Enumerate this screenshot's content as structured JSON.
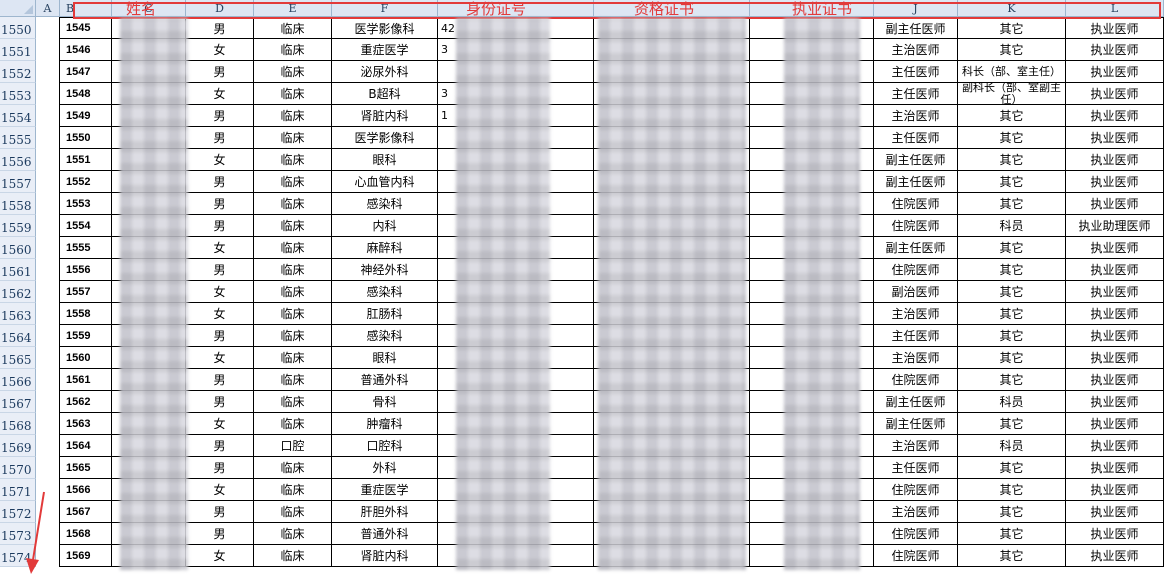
{
  "columns": [
    {
      "id": "A",
      "letter": "A"
    },
    {
      "id": "B",
      "letter": "B"
    },
    {
      "id": "C",
      "letter": "C"
    },
    {
      "id": "D",
      "letter": "D"
    },
    {
      "id": "E",
      "letter": "E"
    },
    {
      "id": "F",
      "letter": "F"
    },
    {
      "id": "G",
      "letter": ""
    },
    {
      "id": "H",
      "letter": ""
    },
    {
      "id": "I",
      "letter": ""
    },
    {
      "id": "J",
      "letter": "J"
    },
    {
      "id": "K",
      "letter": "K"
    },
    {
      "id": "L",
      "letter": "L"
    }
  ],
  "annotation_labels": {
    "name": "姓名",
    "id_number": "身份证号",
    "qualification_cert": "资格证书",
    "practice_cert": "执业证书"
  },
  "rows": [
    {
      "row": "1550",
      "seq": "1545",
      "gender": "男",
      "category": "临床",
      "dept": "医学影像科",
      "id_frag": "42",
      "title": "副主任医师",
      "post": "其它",
      "qual": "执业医师"
    },
    {
      "row": "1551",
      "seq": "1546",
      "gender": "女",
      "category": "临床",
      "dept": "重症医学",
      "id_frag": "3",
      "title": "主治医师",
      "post": "其它",
      "qual": "执业医师"
    },
    {
      "row": "1552",
      "seq": "1547",
      "gender": "男",
      "category": "临床",
      "dept": "泌尿外科",
      "id_frag": "",
      "title": "主任医师",
      "post": "科长（部、室主任）",
      "qual": "执业医师"
    },
    {
      "row": "1553",
      "seq": "1548",
      "gender": "女",
      "category": "临床",
      "dept": "B超科",
      "id_frag": "3",
      "title": "主任医师",
      "post": "副科长（部、室副主任）",
      "qual": "执业医师"
    },
    {
      "row": "1554",
      "seq": "1549",
      "gender": "男",
      "category": "临床",
      "dept": "肾脏内科",
      "id_frag": "1",
      "title": "主治医师",
      "post": "其它",
      "qual": "执业医师"
    },
    {
      "row": "1555",
      "seq": "1550",
      "gender": "男",
      "category": "临床",
      "dept": "医学影像科",
      "id_frag": "",
      "title": "主任医师",
      "post": "其它",
      "qual": "执业医师"
    },
    {
      "row": "1556",
      "seq": "1551",
      "gender": "女",
      "category": "临床",
      "dept": "眼科",
      "id_frag": "",
      "title": "副主任医师",
      "post": "其它",
      "qual": "执业医师"
    },
    {
      "row": "1557",
      "seq": "1552",
      "gender": "男",
      "category": "临床",
      "dept": "心血管内科",
      "id_frag": "",
      "title": "副主任医师",
      "post": "其它",
      "qual": "执业医师"
    },
    {
      "row": "1558",
      "seq": "1553",
      "gender": "男",
      "category": "临床",
      "dept": "感染科",
      "id_frag": "",
      "title": "住院医师",
      "post": "其它",
      "qual": "执业医师"
    },
    {
      "row": "1559",
      "seq": "1554",
      "gender": "男",
      "category": "临床",
      "dept": "内科",
      "id_frag": "",
      "title": "住院医师",
      "post": "科员",
      "qual": "执业助理医师"
    },
    {
      "row": "1560",
      "seq": "1555",
      "gender": "女",
      "category": "临床",
      "dept": "麻醉科",
      "id_frag": "",
      "title": "副主任医师",
      "post": "其它",
      "qual": "执业医师"
    },
    {
      "row": "1561",
      "seq": "1556",
      "gender": "男",
      "category": "临床",
      "dept": "神经外科",
      "id_frag": "",
      "title": "住院医师",
      "post": "其它",
      "qual": "执业医师"
    },
    {
      "row": "1562",
      "seq": "1557",
      "gender": "女",
      "category": "临床",
      "dept": "感染科",
      "id_frag": "",
      "title": "副治医师",
      "post": "其它",
      "qual": "执业医师"
    },
    {
      "row": "1563",
      "seq": "1558",
      "gender": "女",
      "category": "临床",
      "dept": "肛肠科",
      "id_frag": "",
      "title": "主治医师",
      "post": "其它",
      "qual": "执业医师"
    },
    {
      "row": "1564",
      "seq": "1559",
      "gender": "男",
      "category": "临床",
      "dept": "感染科",
      "id_frag": "",
      "title": "主任医师",
      "post": "其它",
      "qual": "执业医师"
    },
    {
      "row": "1565",
      "seq": "1560",
      "gender": "女",
      "category": "临床",
      "dept": "眼科",
      "id_frag": "",
      "title": "主治医师",
      "post": "其它",
      "qual": "执业医师"
    },
    {
      "row": "1566",
      "seq": "1561",
      "gender": "男",
      "category": "临床",
      "dept": "普通外科",
      "id_frag": "",
      "title": "住院医师",
      "post": "其它",
      "qual": "执业医师"
    },
    {
      "row": "1567",
      "seq": "1562",
      "gender": "男",
      "category": "临床",
      "dept": "骨科",
      "id_frag": "",
      "title": "副主任医师",
      "post": "科员",
      "qual": "执业医师"
    },
    {
      "row": "1568",
      "seq": "1563",
      "gender": "女",
      "category": "临床",
      "dept": "肿瘤科",
      "id_frag": "",
      "title": "副主任医师",
      "post": "其它",
      "qual": "执业医师"
    },
    {
      "row": "1569",
      "seq": "1564",
      "gender": "男",
      "category": "口腔",
      "dept": "口腔科",
      "id_frag": "",
      "title": "主治医师",
      "post": "科员",
      "qual": "执业医师"
    },
    {
      "row": "1570",
      "seq": "1565",
      "gender": "男",
      "category": "临床",
      "dept": "外科",
      "id_frag": "",
      "title": "主任医师",
      "post": "其它",
      "qual": "执业医师"
    },
    {
      "row": "1571",
      "seq": "1566",
      "gender": "女",
      "category": "临床",
      "dept": "重症医学",
      "id_frag": "",
      "title": "住院医师",
      "post": "其它",
      "qual": "执业医师"
    },
    {
      "row": "1572",
      "seq": "1567",
      "gender": "男",
      "category": "临床",
      "dept": "肝胆外科",
      "id_frag": "",
      "title": "主治医师",
      "post": "其它",
      "qual": "执业医师"
    },
    {
      "row": "1573",
      "seq": "1568",
      "gender": "男",
      "category": "临床",
      "dept": "普通外科",
      "id_frag": "",
      "title": "住院医师",
      "post": "其它",
      "qual": "执业医师"
    },
    {
      "row": "1574",
      "seq": "1569",
      "gender": "女",
      "category": "临床",
      "dept": "肾脏内科",
      "id_frag": "",
      "title": "住院医师",
      "post": "其它",
      "qual": "执业医师"
    }
  ],
  "colors": {
    "header_bg": "#dde6f3",
    "annotation": "#e23a3a",
    "grid": "#000000"
  }
}
